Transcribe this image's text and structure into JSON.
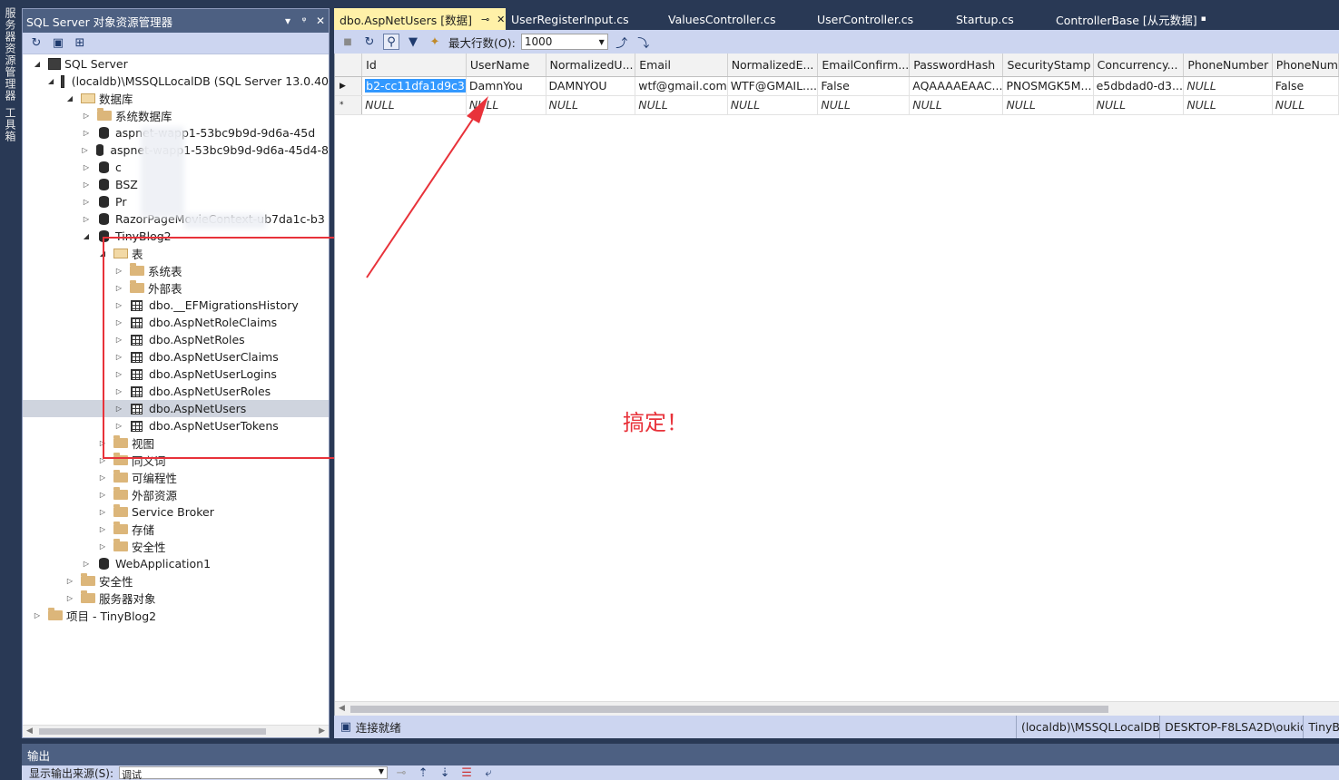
{
  "side_tabs": [
    "服务器资源管理器",
    "工具箱"
  ],
  "explorer": {
    "title": "SQL Server 对象资源管理器",
    "pin": "ꟷ ᵠ",
    "close": "✕",
    "tree": [
      {
        "label": "SQL Server",
        "icon": "sqlroot",
        "level": 0,
        "toggle": "◢"
      },
      {
        "label": "(localdb)\\MSSQLLocalDB (SQL Server 13.0.40",
        "icon": "server",
        "level": 1,
        "toggle": "◢"
      },
      {
        "label": "数据库",
        "icon": "folder-open",
        "level": 2,
        "toggle": "◢"
      },
      {
        "label": "系统数据库",
        "icon": "folder",
        "level": 3,
        "toggle": "▷"
      },
      {
        "label": "aspnet-wapp1-53bc9b9d-9d6a-45d",
        "icon": "db",
        "level": 3,
        "toggle": "▷"
      },
      {
        "label": "aspnet-wapp1-53bc9b9d-9d6a-45d4-8",
        "icon": "db",
        "level": 3,
        "toggle": "▷"
      },
      {
        "label": "c",
        "icon": "db",
        "level": 3,
        "toggle": "▷"
      },
      {
        "label": "BSZ",
        "icon": "db",
        "level": 3,
        "toggle": "▷"
      },
      {
        "label": "Pr",
        "icon": "db",
        "level": 3,
        "toggle": "▷"
      },
      {
        "label": "RazorPageMovieContext-ub7da1c-b3",
        "icon": "db",
        "level": 3,
        "toggle": "▷"
      },
      {
        "label": "TinyBlog2",
        "icon": "db",
        "level": 3,
        "toggle": "◢"
      },
      {
        "label": "表",
        "icon": "folder-open",
        "level": 4,
        "toggle": "◢"
      },
      {
        "label": "系统表",
        "icon": "folder",
        "level": 5,
        "toggle": "▷"
      },
      {
        "label": "外部表",
        "icon": "folder",
        "level": 5,
        "toggle": "▷"
      },
      {
        "label": "dbo.__EFMigrationsHistory",
        "icon": "table",
        "level": 5,
        "toggle": "▷"
      },
      {
        "label": "dbo.AspNetRoleClaims",
        "icon": "table",
        "level": 5,
        "toggle": "▷"
      },
      {
        "label": "dbo.AspNetRoles",
        "icon": "table",
        "level": 5,
        "toggle": "▷"
      },
      {
        "label": "dbo.AspNetUserClaims",
        "icon": "table",
        "level": 5,
        "toggle": "▷"
      },
      {
        "label": "dbo.AspNetUserLogins",
        "icon": "table",
        "level": 5,
        "toggle": "▷"
      },
      {
        "label": "dbo.AspNetUserRoles",
        "icon": "table",
        "level": 5,
        "toggle": "▷"
      },
      {
        "label": "dbo.AspNetUsers",
        "icon": "table",
        "level": 5,
        "toggle": "▷",
        "selected": true
      },
      {
        "label": "dbo.AspNetUserTokens",
        "icon": "table",
        "level": 5,
        "toggle": "▷"
      },
      {
        "label": "视图",
        "icon": "folder",
        "level": 4,
        "toggle": "▷"
      },
      {
        "label": "同义词",
        "icon": "folder",
        "level": 4,
        "toggle": "▷"
      },
      {
        "label": "可编程性",
        "icon": "folder",
        "level": 4,
        "toggle": "▷"
      },
      {
        "label": "外部资源",
        "icon": "folder",
        "level": 4,
        "toggle": "▷"
      },
      {
        "label": "Service Broker",
        "icon": "folder",
        "level": 4,
        "toggle": "▷"
      },
      {
        "label": "存储",
        "icon": "folder",
        "level": 4,
        "toggle": "▷"
      },
      {
        "label": "安全性",
        "icon": "folder",
        "level": 4,
        "toggle": "▷"
      },
      {
        "label": "WebApplication1",
        "icon": "db",
        "level": 3,
        "toggle": "▷"
      },
      {
        "label": "安全性",
        "icon": "folder",
        "level": 2,
        "toggle": "▷"
      },
      {
        "label": "服务器对象",
        "icon": "folder",
        "level": 2,
        "toggle": "▷"
      },
      {
        "label": "项目 - TinyBlog2",
        "icon": "folder",
        "level": 0,
        "toggle": "▷"
      }
    ]
  },
  "doc_tabs": [
    {
      "label": "dbo.AspNetUsers [数据]",
      "active": true,
      "pin": "⊸",
      "close": "✕"
    },
    {
      "label": "UserRegisterInput.cs"
    },
    {
      "label": "ValuesController.cs"
    },
    {
      "label": "UserController.cs"
    },
    {
      "label": "Startup.cs"
    },
    {
      "label": "ControllerBase [从元数据]",
      "lock": "🔒"
    }
  ],
  "doc_toolbar": {
    "max_rows_label": "最大行数(O):",
    "max_rows_value": "1000"
  },
  "grid": {
    "columns": [
      "Id",
      "UserName",
      "NormalizedU...",
      "Email",
      "NormalizedE...",
      "EmailConfirm...",
      "PasswordHash",
      "SecurityStamp",
      "Concurrency...",
      "PhoneNumber",
      "PhoneNum"
    ],
    "rows": [
      {
        "marker": "▶",
        "cells": [
          "b2-cc11dfa1d9c3",
          "DamnYou",
          "DAMNYOU",
          "wtf@gmail.com",
          "WTF@GMAIL....",
          "False",
          "AQAAAAEAAC...",
          "PNOSMGK5M...",
          "e5dbdad0-d3...",
          "NULL",
          "False"
        ]
      },
      {
        "marker": "*",
        "cells": [
          "NULL",
          "NULL",
          "NULL",
          "NULL",
          "NULL",
          "NULL",
          "NULL",
          "NULL",
          "NULL",
          "NULL",
          "NULL"
        ]
      }
    ]
  },
  "annotation": {
    "text": "搞定！",
    "color": "#e8323a"
  },
  "status_bar": {
    "state": "连接就绪",
    "server": "(localdb)\\MSSQLLocalDB",
    "user": "DESKTOP-F8LSA2D\\oukic",
    "db": "TinyBl"
  },
  "output": {
    "title": "输出",
    "source_label": "显示输出来源(S):",
    "source_value": "调试"
  }
}
